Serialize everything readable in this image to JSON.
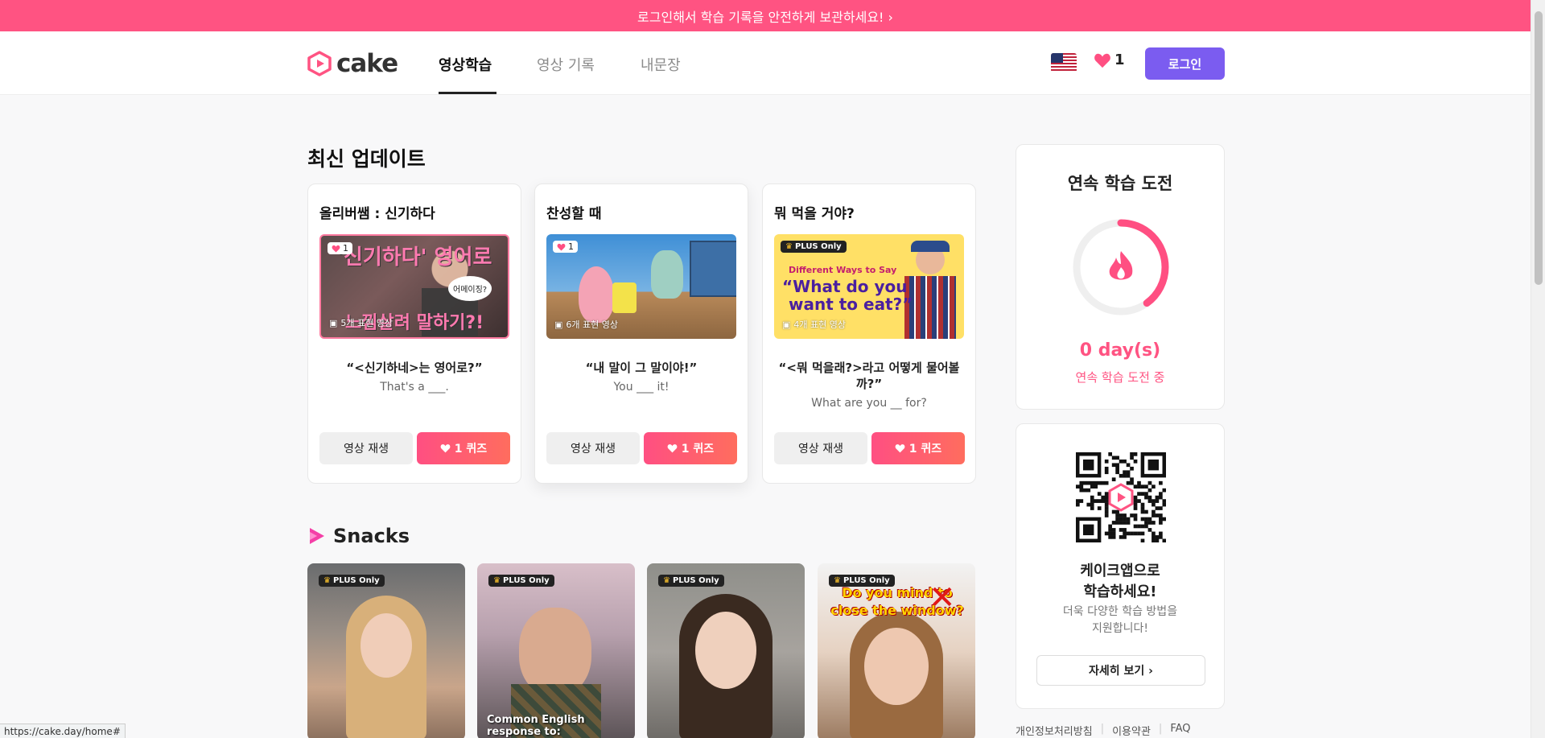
{
  "banner": {
    "text": "로그인해서 학습 기록을 안전하게 보관하세요! ›"
  },
  "header": {
    "logo_text": "cake",
    "tabs": [
      {
        "label": "영상학습",
        "active": true
      },
      {
        "label": "영상 기록",
        "active": false
      },
      {
        "label": "내문장",
        "active": false
      }
    ],
    "language_flag": "us-flag-icon",
    "heart_count": "1",
    "login_label": "로그인"
  },
  "latest": {
    "title": "최신 업데이트",
    "cards": [
      {
        "title": "올리버쌤 : 신기하다",
        "heart_badge": "1",
        "thumb_headline": "'신기하다' 영어로",
        "thumb_headline2": "느낌살려 말하기?!",
        "thumb_bubble": "어메이징?",
        "thumb_count": "5개 표현 영상",
        "quote": "“<신기하네>는 영어로?”",
        "sub": "That's a ___.",
        "play_label": "영상 재생",
        "quiz_label": "1 퀴즈"
      },
      {
        "title": "찬성할 때",
        "heart_badge": "1",
        "thumb_count": "6개 표현 영상",
        "quote": "“내 말이 그 말이야!”",
        "sub": "You ___ it!",
        "play_label": "영상 재생",
        "quiz_label": "1 퀴즈"
      },
      {
        "title": "뭐 먹을 거야?",
        "plus_badge": "PLUS Only",
        "thumb_line1": "Different Ways to Say",
        "thumb_line2": "“What do you",
        "thumb_line3": "want to eat?”",
        "thumb_count": "4개 표현 영상",
        "quote": "“<뭐 먹을래?>라고 어떻게 물어볼까?”",
        "sub": "What are you __ for?",
        "play_label": "영상 재생",
        "quiz_label": "1 퀴즈"
      }
    ]
  },
  "snacks": {
    "title": "Snacks",
    "items": [
      {
        "badge": "PLUS Only",
        "caption": ""
      },
      {
        "badge": "PLUS Only",
        "caption": "Common English response to:"
      },
      {
        "badge": "PLUS Only",
        "caption": ""
      },
      {
        "badge": "PLUS Only",
        "top_text": "Do you mind to close the window?",
        "caption": ""
      }
    ]
  },
  "streak": {
    "title": "연속 학습 도전",
    "days": "0 day(s)",
    "sub": "연속 학습 도전 중",
    "progress": 0.4
  },
  "app_promo": {
    "title_line1": "케이크앱으로",
    "title_line2": "학습하세요!",
    "sub_line1": "더욱 다양한 학습 방법을",
    "sub_line2": "지원합니다!",
    "more_label": "자세히 보기 ›"
  },
  "footer": {
    "links": [
      "개인정보처리방침",
      "이용약관",
      "FAQ"
    ]
  },
  "status_url": "https://cake.day/home#",
  "colors": {
    "brand_pink": "#ff5382",
    "login_purple": "#7b5cf0"
  }
}
